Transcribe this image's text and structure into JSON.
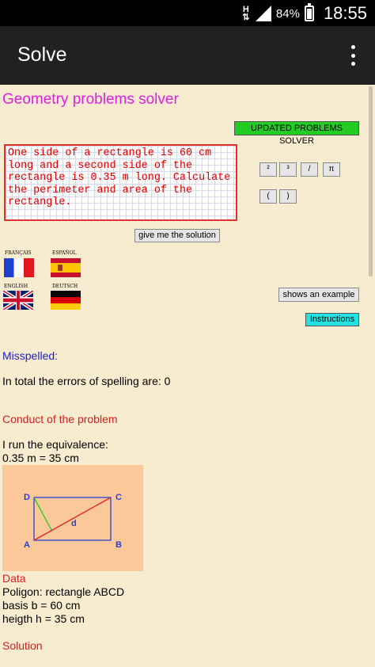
{
  "status_bar": {
    "network": "H",
    "battery": "84%",
    "battery_level": 0.84,
    "time": "18:55"
  },
  "app_bar": {
    "title": "Solve",
    "menu_icon": "more-vert-icon"
  },
  "page": {
    "title": "Geometry problems solver",
    "updated_button": "UPDATED PROBLEMS SOLVER",
    "problem_text": "One side of a rectangle is 60 cm long and a second side of the rectangle is 0.35 m long. Calculate the perimeter and area of the rectangle.",
    "symbols": [
      "²",
      "³",
      "/",
      "π",
      "(",
      ")"
    ],
    "solve_button": "give me the solution",
    "languages": [
      {
        "label": "FRANÇAIS",
        "flag": "france-flag-icon"
      },
      {
        "label": "ESPAÑOL",
        "flag": "spain-flag-icon"
      },
      {
        "label": "ENGLISH",
        "flag": "uk-flag-icon"
      },
      {
        "label": "DEUTSCH",
        "flag": "germany-flag-icon"
      }
    ],
    "example_button": "shows an example",
    "instructions_button": "Instructions",
    "misspelled_heading": "Misspelled:",
    "spelling_errors": "In total the errors of spelling are: 0",
    "conduct_heading": "Conduct of the problem",
    "equivalence_intro": "I run the equivalence:",
    "equivalence": "0.35 m = 35 cm",
    "figure": {
      "labels": [
        "D",
        "C",
        "A",
        "B"
      ],
      "diagonal": "d"
    },
    "data_heading": "Data",
    "data_lines": [
      "Poligon: rectangle ABCD",
      "basis b = 60 cm",
      "heigth h = 35 cm"
    ],
    "solution_heading": "Solution"
  },
  "colors": {
    "background": "#f8ecd0",
    "title": "#e020e0",
    "updated_button": "#22cc22",
    "instructions_button": "#22e2e2",
    "error_text": "#e00000",
    "heading_blue": "#2020c0",
    "heading_red": "#d02020",
    "figure_bg": "#fbc89a"
  }
}
